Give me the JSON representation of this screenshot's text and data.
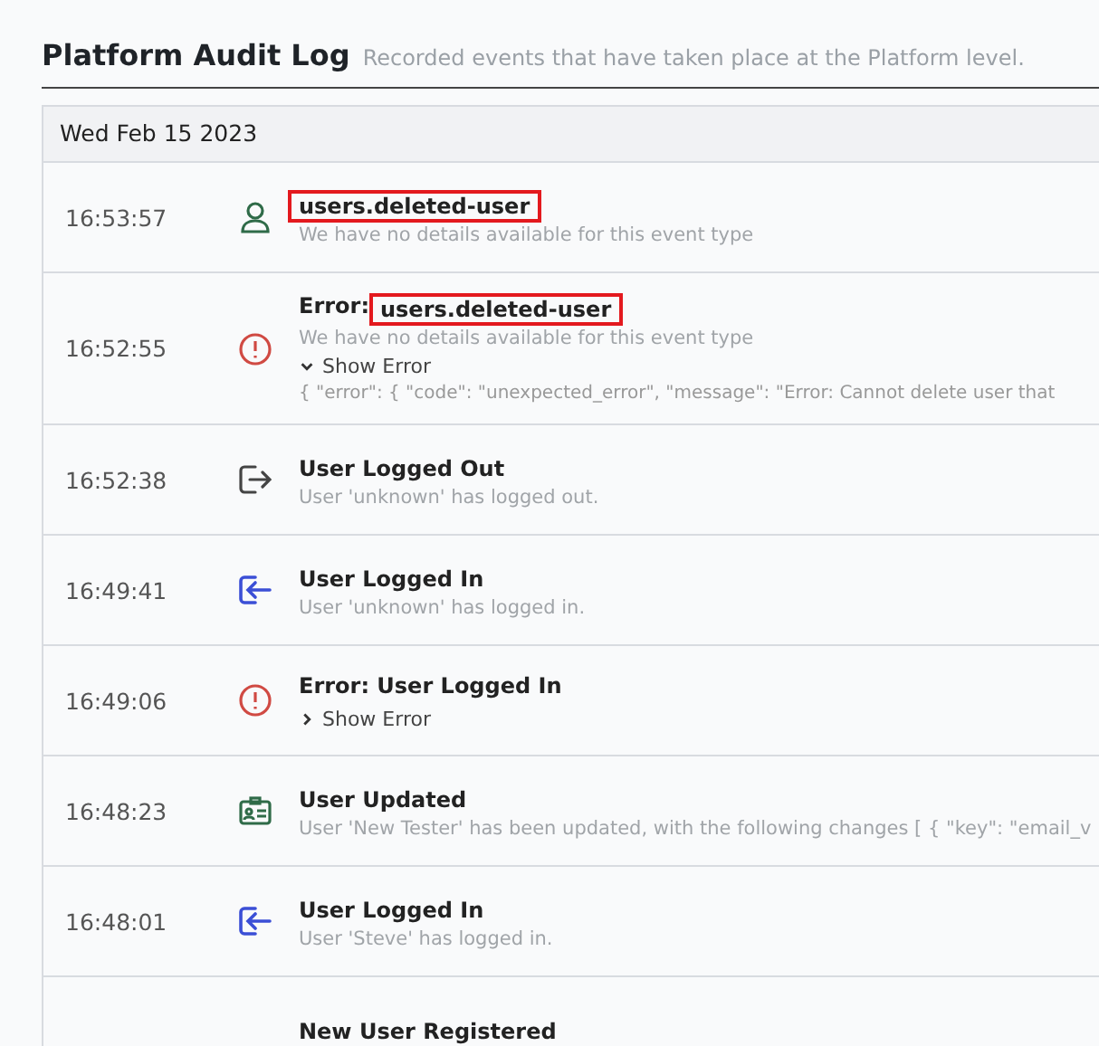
{
  "page": {
    "title": "Platform Audit Log",
    "subtitle": "Recorded events that have taken place at the Platform level."
  },
  "log": {
    "date": "Wed Feb 15 2023",
    "events": [
      {
        "time": "16:53:57",
        "kind": "user",
        "title": "users.deleted-user",
        "highlighted": true,
        "details": "We have no details available for this event type"
      },
      {
        "time": "16:52:55",
        "kind": "error",
        "title_prefix": "Error: ",
        "title": "users.deleted-user",
        "highlighted": true,
        "details": "We have no details available for this event type",
        "toggle": "Show Error",
        "expanded": true,
        "error_text": "{ \"error\": { \"code\": \"unexpected_error\", \"message\": \"Error: Cannot delete user that"
      },
      {
        "time": "16:52:38",
        "kind": "logout",
        "title": "User Logged Out",
        "highlighted": false,
        "details": "User 'unknown' has logged out."
      },
      {
        "time": "16:49:41",
        "kind": "login",
        "title": "User Logged In",
        "highlighted": false,
        "details": "User 'unknown' has logged in."
      },
      {
        "time": "16:49:06",
        "kind": "error",
        "title": "Error: User Logged In",
        "highlighted": false,
        "toggle": "Show Error",
        "expanded": false
      },
      {
        "time": "16:48:23",
        "kind": "idcard",
        "title": "User Updated",
        "highlighted": false,
        "details": "User 'New Tester' has been updated, with the following changes [ { \"key\": \"email_v"
      },
      {
        "time": "16:48:01",
        "kind": "login",
        "title": "User Logged In",
        "highlighted": false,
        "details": "User 'Steve' has logged in."
      },
      {
        "title": "New User Registered",
        "highlighted": false
      }
    ]
  }
}
